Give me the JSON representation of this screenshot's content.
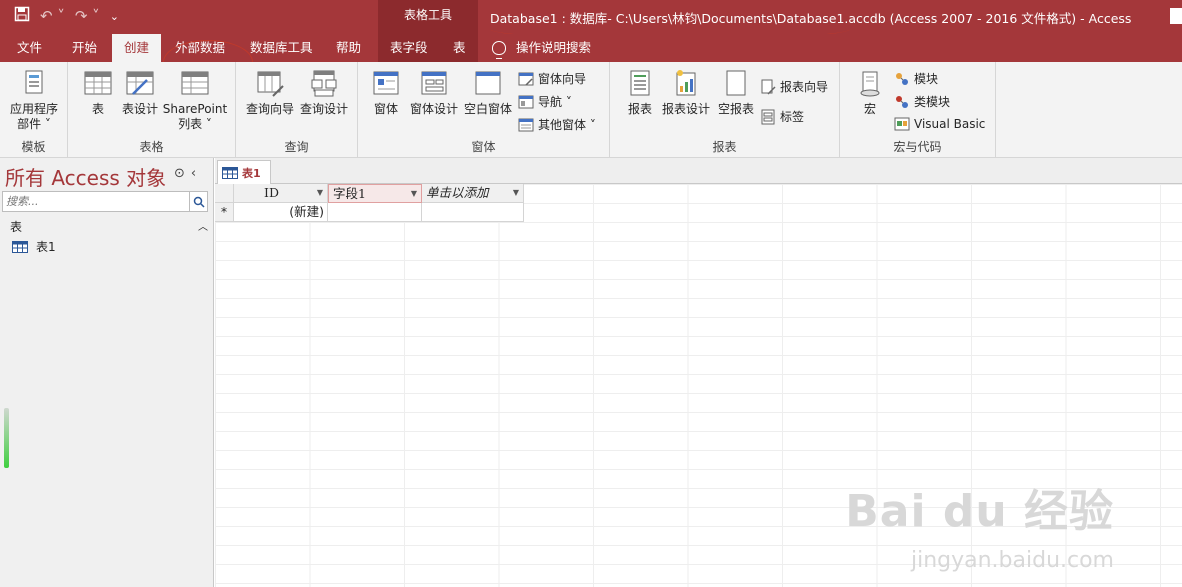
{
  "titlebar": {
    "contextual_tools": "表格工具",
    "document_title": "Database1 : 数据库- C:\\Users\\林钧\\Documents\\Database1.accdb (Access 2007 - 2016 文件格式)  -  Access"
  },
  "tabs": {
    "file": "文件",
    "home": "开始",
    "create": "创建",
    "external": "外部数据",
    "dbtools": "数据库工具",
    "help": "帮助",
    "fields": "表字段",
    "table": "表",
    "tellme": "操作说明搜索"
  },
  "ribbon": {
    "templates": {
      "label": "模板",
      "app_parts": "应用程序\n部件 ˅"
    },
    "tables": {
      "label": "表格",
      "table": "表",
      "table_design": "表设计",
      "sharepoint": "SharePoint\n列表 ˅"
    },
    "queries": {
      "label": "查询",
      "wizard": "查询向导",
      "design": "查询设计"
    },
    "forms": {
      "label": "窗体",
      "form": "窗体",
      "form_design": "窗体设计",
      "blank_form": "空白窗体",
      "form_wizard": "窗体向导",
      "navigation": "导航 ˅",
      "more_forms": "其他窗体 ˅"
    },
    "reports": {
      "label": "报表",
      "report": "报表",
      "report_design": "报表设计",
      "blank_report": "空报表",
      "report_wizard": "报表向导",
      "labels": "标签"
    },
    "macros": {
      "label": "宏与代码",
      "macro": "宏",
      "module": "模块",
      "class_module": "类模块",
      "vba": "Visual Basic"
    }
  },
  "navpane": {
    "title": "所有 Access 对象",
    "search_placeholder": "搜索...",
    "section": "表",
    "items": [
      {
        "label": "表1"
      }
    ]
  },
  "document": {
    "tab_label": "表1",
    "columns": [
      "ID",
      "字段1",
      "单击以添加"
    ],
    "new_row_marker": "*",
    "new_row_id": "(新建)"
  },
  "watermark": {
    "main": "Bai du 经验",
    "sub": "jingyan.baidu.com"
  },
  "colors": {
    "accent": "#a4373a",
    "ribbon_bg": "#f3f3f3"
  }
}
